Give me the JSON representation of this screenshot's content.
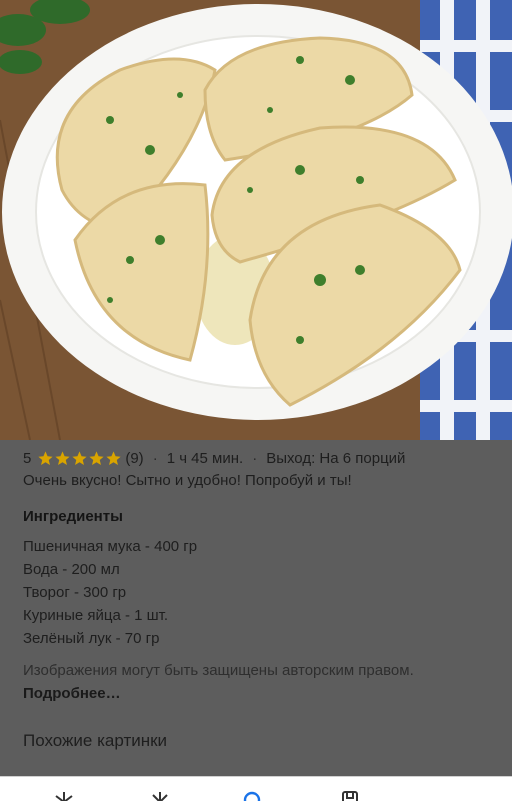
{
  "recipe": {
    "rating": "5",
    "stars_count": 5,
    "review_count": "(9)",
    "time": "1 ч 45 мин.",
    "yield": "Выход: На 6 порций",
    "separator": "·",
    "description": "Очень вкусно! Сытно и удобно! Попробуй и ты!"
  },
  "ingredients": {
    "title": "Ингредиенты",
    "items": [
      "Пшеничная мука - 400 гр",
      "Вода - 200 мл",
      "Творог - 300 гр",
      "Куриные яйца - 1 шт.",
      "Зелёный лук - 70 гр"
    ]
  },
  "copyright": {
    "text": "Изображения могут быть защищены авторским правом.",
    "more_link": "Подробнее…"
  },
  "similar_images_label": "Похожие картинки",
  "colors": {
    "star": "#d9a400",
    "overlay": "#5d5d5d",
    "plate": "#f4f4f2",
    "dough": "#ecd9a6"
  },
  "bottom_nav": {
    "icons": [
      "discover-icon",
      "updates-icon",
      "search-icon",
      "collections-icon",
      "more-icon"
    ]
  }
}
